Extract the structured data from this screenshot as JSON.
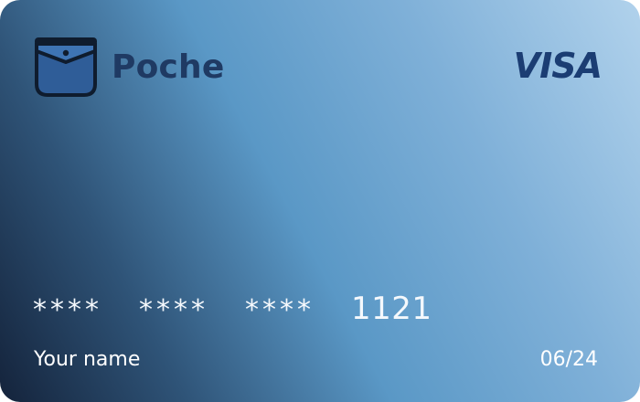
{
  "card": {
    "brand": "Poche",
    "network": "VISA",
    "number_groups": [
      "****",
      "****",
      "****",
      "1121"
    ],
    "holder_name": "Your name",
    "expiry": "06/24"
  },
  "icons": {
    "brand_logo": "pocket-icon"
  },
  "colors": {
    "brand_text": "#1f3a63",
    "network_text": "#1b3d73",
    "gradient_dark": "#14233b",
    "gradient_mid": "#5a98c6",
    "gradient_light": "#b1d2ec",
    "number_text": "#f4f8fc"
  }
}
